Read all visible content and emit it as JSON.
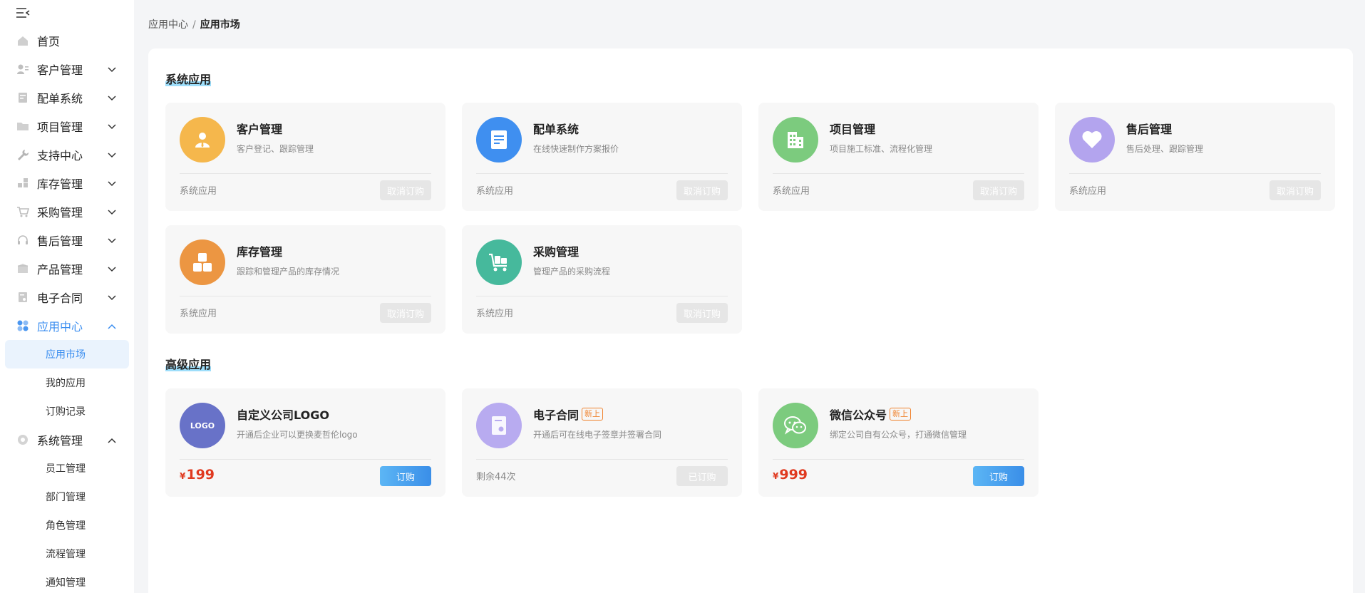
{
  "sidebar": {
    "items": [
      {
        "label": "首页",
        "icon": "home-icon"
      },
      {
        "label": "客户管理",
        "icon": "customer-icon"
      },
      {
        "label": "配单系统",
        "icon": "order-icon"
      },
      {
        "label": "项目管理",
        "icon": "folder-icon"
      },
      {
        "label": "支持中心",
        "icon": "wrench-icon"
      },
      {
        "label": "库存管理",
        "icon": "inventory-icon"
      },
      {
        "label": "采购管理",
        "icon": "cart-icon"
      },
      {
        "label": "售后管理",
        "icon": "headset-icon"
      },
      {
        "label": "产品管理",
        "icon": "box-icon"
      },
      {
        "label": "电子合同",
        "icon": "contract-icon"
      },
      {
        "label": "应用中心",
        "icon": "apps-icon"
      },
      {
        "label": "系统管理",
        "icon": "settings-icon"
      }
    ],
    "app_center_sub": [
      "应用市场",
      "我的应用",
      "订购记录"
    ],
    "system_sub": [
      "员工管理",
      "部门管理",
      "角色管理",
      "流程管理",
      "通知管理"
    ]
  },
  "breadcrumb": {
    "parent": "应用中心",
    "separator": "/",
    "current": "应用市场"
  },
  "sections": {
    "system_apps": {
      "title": "系统应用",
      "cards": [
        {
          "name": "客户管理",
          "desc": "客户登记、跟踪管理",
          "footer": "系统应用",
          "button": "取消订购",
          "color": "#f5b74c",
          "icon": "person-icon"
        },
        {
          "name": "配单系统",
          "desc": "在线快速制作方案报价",
          "footer": "系统应用",
          "button": "取消订购",
          "color": "#3f8ff0",
          "icon": "document-icon"
        },
        {
          "name": "项目管理",
          "desc": "项目施工标准、流程化管理",
          "footer": "系统应用",
          "button": "取消订购",
          "color": "#7ccb7e",
          "icon": "building-icon"
        },
        {
          "name": "售后管理",
          "desc": "售后处理、跟踪管理",
          "footer": "系统应用",
          "button": "取消订购",
          "color": "#b3a4ee",
          "icon": "heart-icon"
        },
        {
          "name": "库存管理",
          "desc": "跟踪和管理产品的库存情况",
          "footer": "系统应用",
          "button": "取消订购",
          "color": "#ec9642",
          "icon": "blocks-icon"
        },
        {
          "name": "采购管理",
          "desc": "管理产品的采购流程",
          "footer": "系统应用",
          "button": "取消订购",
          "color": "#46b99c",
          "icon": "cart-icon"
        }
      ]
    },
    "advanced_apps": {
      "title": "高级应用",
      "cards": [
        {
          "name": "自定义公司LOGO",
          "badge": "",
          "desc": "开通后企业可以更换麦哲伦logo",
          "price_currency": "¥",
          "price": "199",
          "footer": "",
          "button": "订购",
          "color": "#6872c8",
          "icon": "logo-icon",
          "icon_text": "LOGO"
        },
        {
          "name": "电子合同",
          "badge": "新上",
          "desc": "开通后可在线电子签章并签署合同",
          "price_currency": "",
          "price": "",
          "footer": "剩余44次",
          "button": "已订购",
          "color": "#b8abf0",
          "icon": "contract-icon",
          "icon_text": ""
        },
        {
          "name": "微信公众号",
          "badge": "新上",
          "desc": "绑定公司自有公众号，打通微信管理",
          "price_currency": "¥",
          "price": "999",
          "footer": "",
          "button": "订购",
          "color": "#7ccb7e",
          "icon": "wechat-icon",
          "icon_text": ""
        }
      ]
    }
  }
}
